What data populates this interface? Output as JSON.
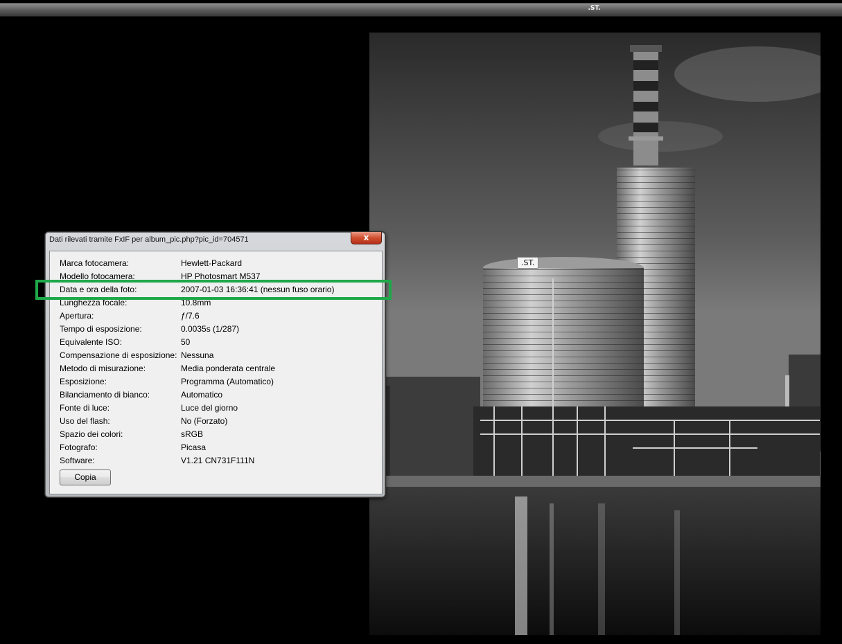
{
  "window": {
    "title": ".ST."
  },
  "photo": {
    "tag_label": ".ST."
  },
  "dialog": {
    "title": "Dati rilevati tramite FxIF per album_pic.php?pic_id=704571",
    "close_label": "x",
    "rows": [
      {
        "label": "Marca fotocamera:",
        "value": "Hewlett-Packard"
      },
      {
        "label": "Modello fotocamera:",
        "value": "HP Photosmart M537"
      },
      {
        "label": "Data e ora della foto:",
        "value": "2007-01-03 16:36:41 (nessun fuso orario)"
      },
      {
        "label": "Lunghezza focale:",
        "value": "10.8mm"
      },
      {
        "label": "Apertura:",
        "value": "ƒ/7.6"
      },
      {
        "label": "Tempo di esposizione:",
        "value": "0.0035s (1/287)"
      },
      {
        "label": "Equivalente ISO:",
        "value": "50"
      },
      {
        "label": "Compensazione di esposizione:",
        "value": "Nessuna"
      },
      {
        "label": "Metodo di misurazione:",
        "value": "Media ponderata centrale"
      },
      {
        "label": "Esposizione:",
        "value": "Programma (Automatico)"
      },
      {
        "label": "Bilanciamento di bianco:",
        "value": "Automatico"
      },
      {
        "label": "Fonte di luce:",
        "value": "Luce del giorno"
      },
      {
        "label": "Uso del flash:",
        "value": "No (Forzato)"
      },
      {
        "label": "Spazio dei colori:",
        "value": "sRGB"
      },
      {
        "label": "Fotografo:",
        "value": "Picasa"
      },
      {
        "label": "Software:",
        "value": "V1.21 CN731F111N"
      }
    ],
    "copy_label": "Copia"
  },
  "colors": {
    "highlight": "#1fa84a",
    "close_button": "#d0502f"
  }
}
